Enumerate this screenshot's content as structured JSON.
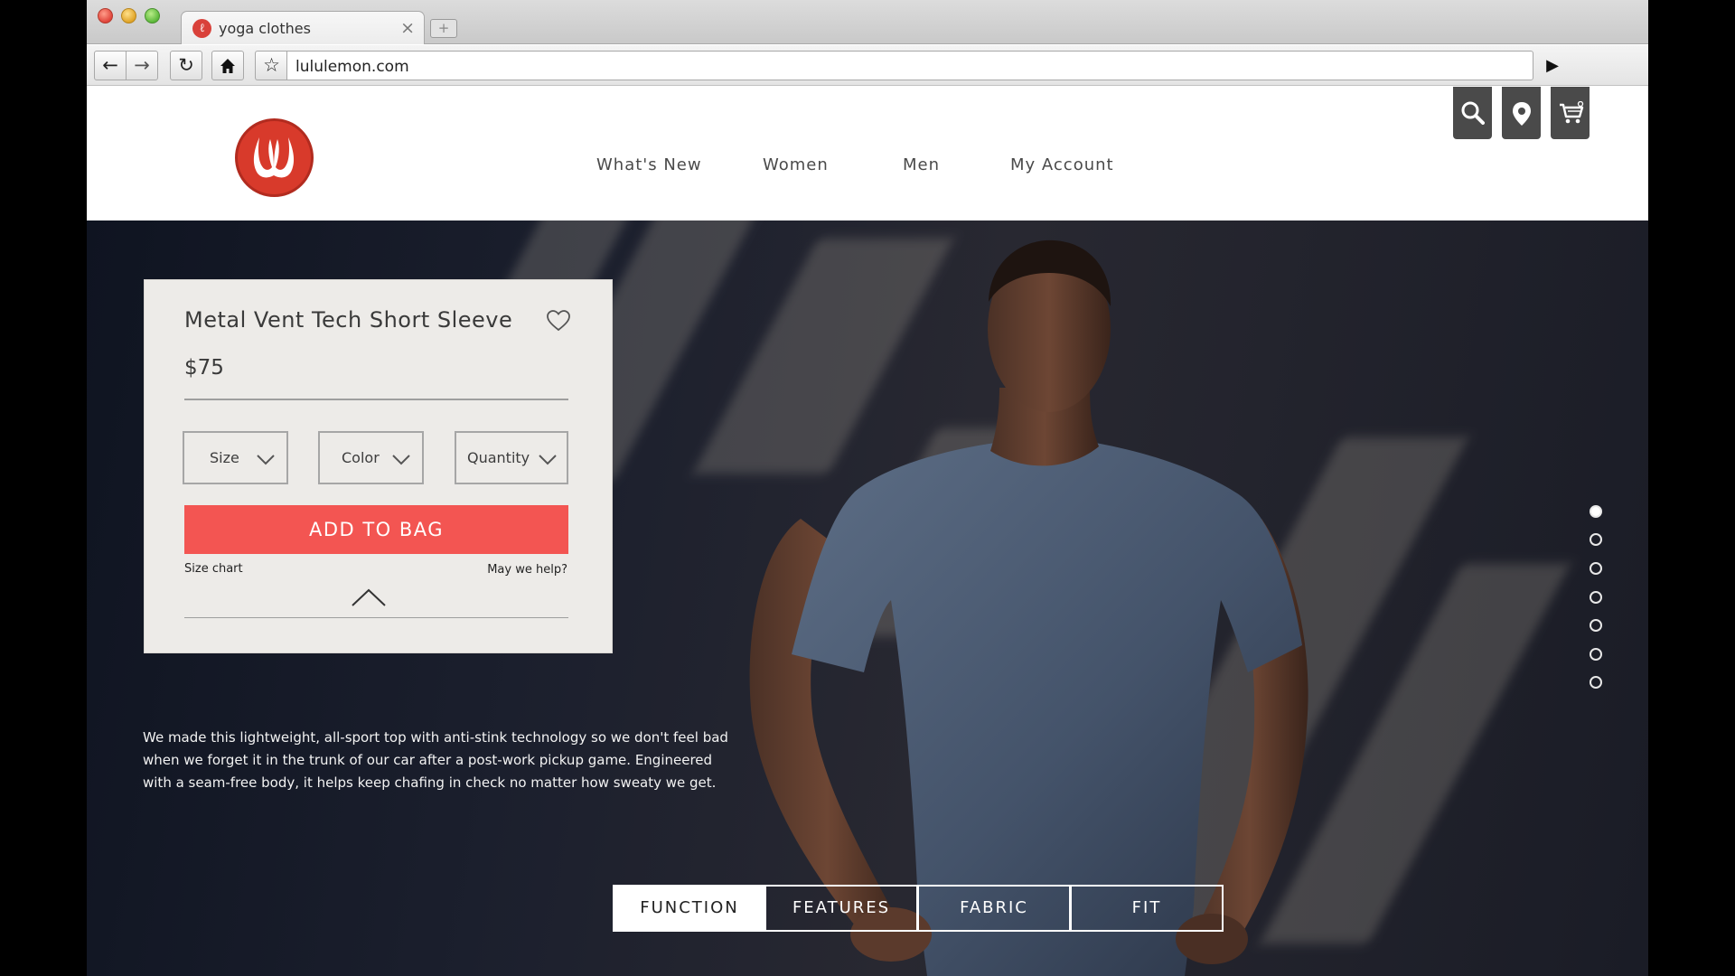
{
  "browser": {
    "tab_title": "yoga clothes",
    "tab_favicon": "lululemon-favicon",
    "url": "lululemon.com",
    "icons": [
      "back-arrow-icon",
      "forward-arrow-icon",
      "reload-icon",
      "home-icon",
      "bookmark-star-icon",
      "go-arrow-icon",
      "close-icon",
      "new-tab-icon"
    ]
  },
  "site": {
    "logo": "lululemon-logo",
    "nav": [
      {
        "label": "What's New"
      },
      {
        "label": "Women"
      },
      {
        "label": "Men"
      },
      {
        "label": "My Account"
      }
    ],
    "utility_icons": [
      "search-icon",
      "location-pin-icon",
      "shopping-cart-icon"
    ]
  },
  "product": {
    "name": "Metal Vent Tech Short Sleeve",
    "price": "$75",
    "selects": {
      "size": "Size",
      "color": "Color",
      "quantity": "Quantity"
    },
    "add_to_bag": "ADD TO BAG",
    "size_chart": "Size chart",
    "help": "May we help?",
    "description": "We made this lightweight, all-sport top with anti-stink technology so we don't feel bad when we forget it in the trunk of our car after a post-work pickup game. Engineered with a seam-free body, it helps keep chafing in check no matter how sweaty we get."
  },
  "carousel": {
    "slide_count": 7,
    "active_slide": 1
  },
  "info_tabs": [
    {
      "label": "FUNCTION",
      "active": true
    },
    {
      "label": "FEATURES",
      "active": false
    },
    {
      "label": "FABRIC",
      "active": false
    },
    {
      "label": "FIT",
      "active": false
    }
  ],
  "colors": {
    "brand_red": "#d83a2b",
    "add_to_bag_bg": "#f35552",
    "card_bg": "#edebe8",
    "utility_btn_bg": "#4a4a4a"
  }
}
